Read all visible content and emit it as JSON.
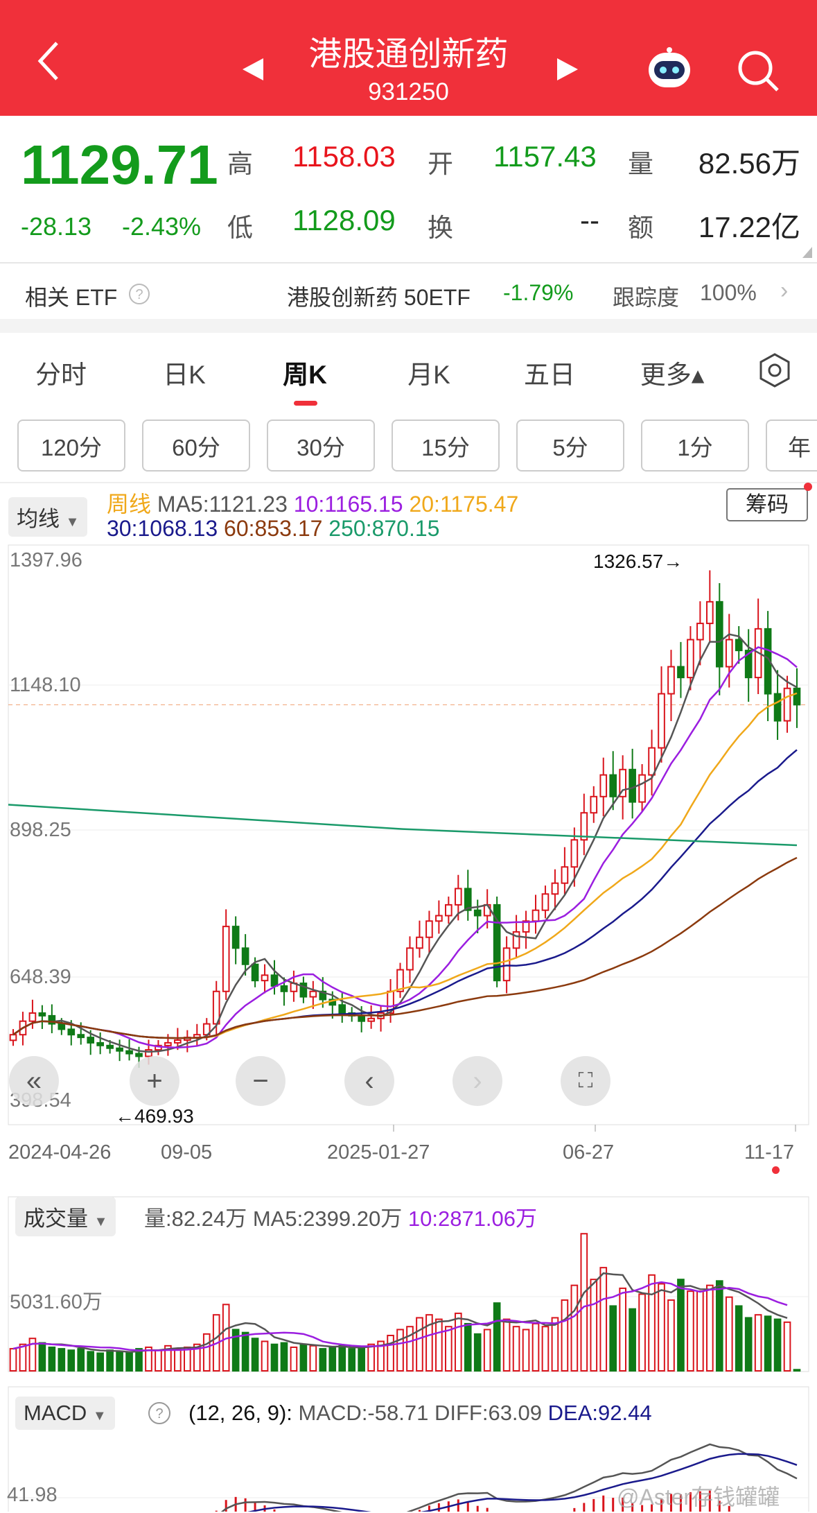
{
  "header": {
    "title": "港股通创新药",
    "code": "931250",
    "prev_icon": "triangle-left",
    "next_icon": "triangle-right"
  },
  "quote": {
    "price": "1129.71",
    "change": "-28.13",
    "change_pct": "-2.43%",
    "high_label": "高",
    "high": "1158.03",
    "open_label": "开",
    "open": "1157.43",
    "vol_label": "量",
    "vol": "82.56万",
    "low_label": "低",
    "low": "1128.09",
    "turn_label": "换",
    "turn": "--",
    "amount_label": "额",
    "amount": "17.22亿"
  },
  "etf": {
    "label": "相关 ETF",
    "name": "港股创新药 50ETF",
    "pct": "-1.79%",
    "track_label": "跟踪度",
    "track": "100%"
  },
  "tabs": [
    {
      "label": "分时"
    },
    {
      "label": "日K"
    },
    {
      "label": "周K",
      "active": true
    },
    {
      "label": "月K"
    },
    {
      "label": "五日"
    },
    {
      "label": "更多▴"
    }
  ],
  "periods": [
    "120分",
    "60分",
    "30分",
    "15分",
    "5分",
    "1分",
    "年"
  ],
  "ma_legend": {
    "dropdown": "均线",
    "type": "周线",
    "ma5": "MA5:1121.23",
    "ma10": "10:1165.15",
    "ma20": "20:1175.47",
    "ma30": "30:1068.13",
    "ma60": "60:853.17",
    "ma250": "250:870.15",
    "chip_button": "筹码"
  },
  "colors": {
    "up": "#d9141c",
    "down": "#0f7a17",
    "ma5": "#555555",
    "ma10": "#9b1ee0",
    "ma20": "#f0a81a",
    "ma30": "#1a1a8c",
    "ma60": "#8b3a0e",
    "ma250": "#1a9a6a"
  },
  "chart_data": [
    {
      "type": "candlestick",
      "title": "周K",
      "y_ticks": [
        "1397.96",
        "1148.10",
        "898.25",
        "648.39",
        "398.54"
      ],
      "ylim": [
        398.54,
        1397.96
      ],
      "x_labels": [
        "2024-04-26",
        "09-05",
        "2025-01-27",
        "06-27",
        "11-17"
      ],
      "max_label": "1326.57→",
      "min_label": "←469.93",
      "last_close": 1129.71,
      "closes": [
        520,
        545,
        560,
        555,
        540,
        530,
        520,
        515,
        505,
        500,
        495,
        490,
        485,
        480,
        492,
        500,
        505,
        510,
        515,
        520,
        540,
        600,
        720,
        680,
        650,
        620,
        630,
        610,
        600,
        615,
        590,
        600,
        585,
        575,
        560,
        555,
        545,
        550,
        560,
        600,
        640,
        680,
        700,
        730,
        740,
        760,
        790,
        750,
        740,
        760,
        620,
        680,
        710,
        730,
        750,
        780,
        800,
        830,
        880,
        930,
        960,
        1000,
        960,
        1010,
        950,
        1000,
        1050,
        1150,
        1200,
        1180,
        1250,
        1280,
        1320,
        1200,
        1250,
        1230,
        1180,
        1270,
        1150,
        1100,
        1160,
        1129.71
      ],
      "ma250": [
        945,
        900,
        870
      ]
    },
    {
      "type": "bar",
      "title": "成交量",
      "y_tick": "5031.60万",
      "dropdown": "成交量",
      "vol": "量:82.24万",
      "ma5": "MA5:2399.20万",
      "ma10": "10:2871.06万",
      "values": [
        1500,
        1800,
        2200,
        1900,
        1600,
        1500,
        1400,
        1500,
        1300,
        1200,
        1400,
        1300,
        1200,
        1500,
        1600,
        1400,
        1700,
        1500,
        1600,
        1800,
        2500,
        3800,
        4500,
        2800,
        2600,
        2200,
        2000,
        1800,
        1900,
        1600,
        1800,
        1700,
        1500,
        1600,
        1700,
        1500,
        1600,
        1800,
        2000,
        2400,
        2800,
        3000,
        3600,
        3800,
        3500,
        3000,
        3900,
        3200,
        2500,
        2800,
        4600,
        3500,
        3000,
        2800,
        3200,
        3000,
        3600,
        4800,
        5800,
        9300,
        6200,
        7000,
        4400,
        5600,
        4200,
        5200,
        6500,
        5900,
        4800,
        6200,
        5400,
        5400,
        5800,
        6100,
        5000,
        4400,
        3600,
        3800,
        3700,
        3500,
        3300,
        82.24
      ]
    },
    {
      "type": "line",
      "title": "MACD",
      "dropdown": "MACD",
      "params": "(12, 26, 9):",
      "macd": "MACD:-58.71",
      "diff": "DIFF:63.09",
      "dea": "DEA:92.44",
      "y_tick": "41.98"
    }
  ],
  "watermark": "@Aster存钱罐罐"
}
